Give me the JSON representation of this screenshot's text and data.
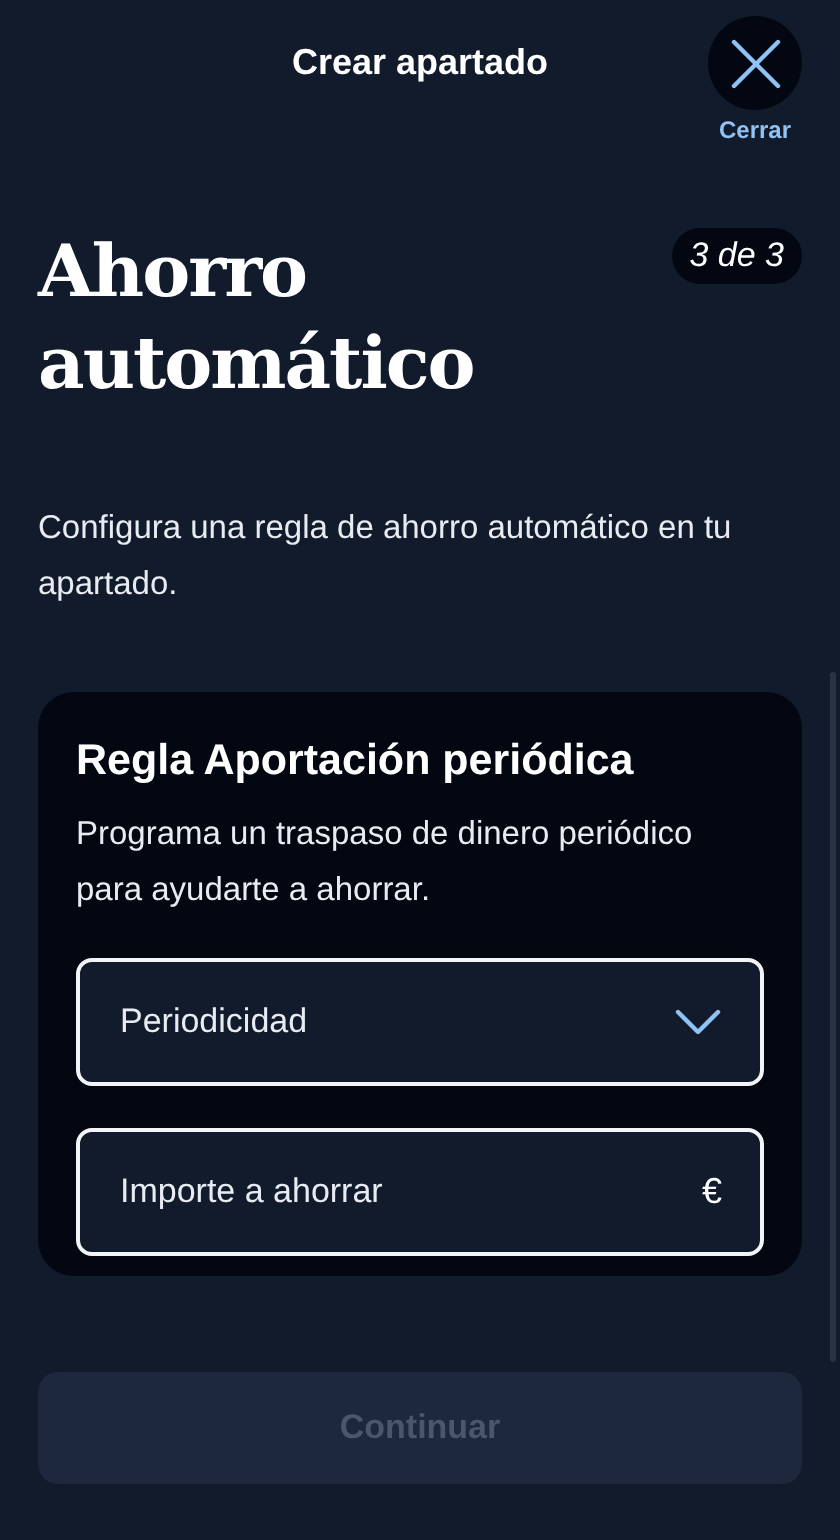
{
  "header": {
    "title": "Crear apartado",
    "close_label": "Cerrar"
  },
  "heading": "Ahorro automático",
  "step": "3 de 3",
  "description": "Configura una regla de ahorro automático en tu apartado.",
  "card": {
    "title": "Regla Aportación periódica",
    "text": "Programa un traspaso de dinero periódico para ayudarte a ahorrar.",
    "fields": [
      {
        "kind": "select",
        "placeholder": "Periodicidad"
      },
      {
        "kind": "amount",
        "placeholder": "Importe a ahorrar",
        "suffix": "€"
      }
    ]
  },
  "continue_button": {
    "label": "Continuar",
    "disabled": true
  }
}
